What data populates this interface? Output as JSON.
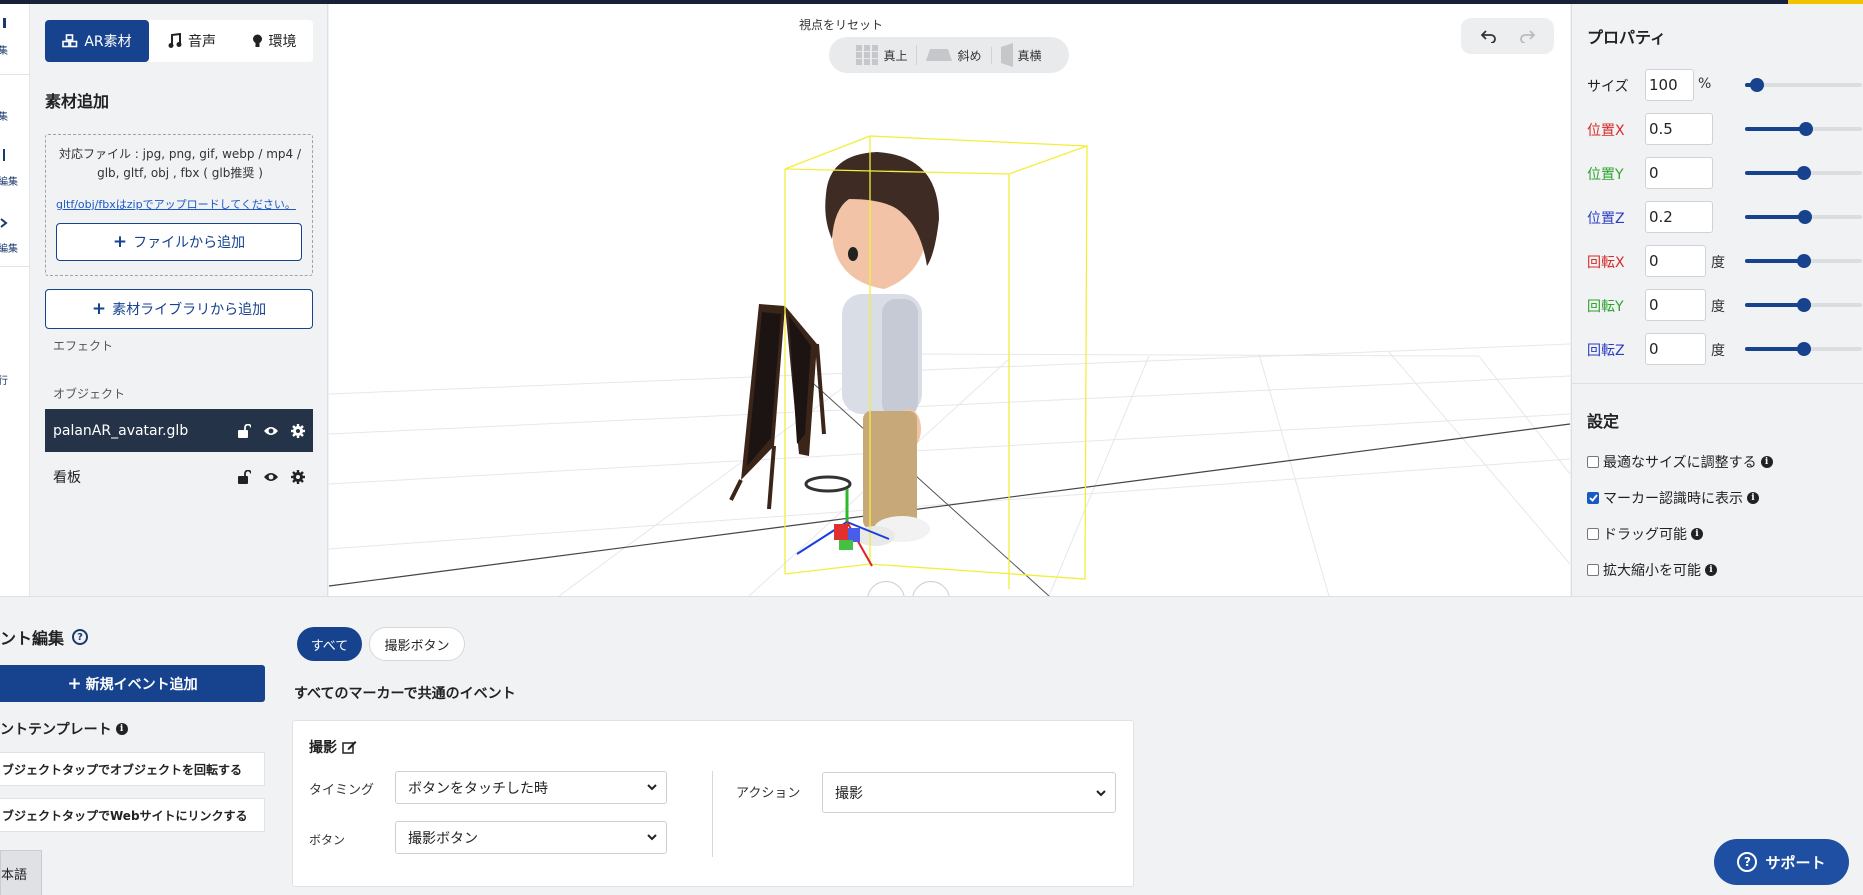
{
  "left_strip": {
    "items": [
      "集",
      "集",
      "編集",
      "編集",
      "行"
    ]
  },
  "asset_panel": {
    "tabs": [
      {
        "label": "AR素材",
        "icon": "cubes-icon"
      },
      {
        "label": "音声",
        "icon": "music-note-icon"
      },
      {
        "label": "環境",
        "icon": "lightbulb-icon"
      }
    ],
    "title": "素材追加",
    "upload_desc": "対応ファイル : jpg, png, gif, webp / mp4 / glb, gltf, obj , fbx ( glb推奨 )",
    "upload_link": "gltf/obj/fbxはzipでアップロードしてください。",
    "add_file_button": "ファイルから追加",
    "add_library_button": "素材ライブラリから追加",
    "effect_label": "エフェクト",
    "object_label": "オブジェクト",
    "objects": [
      {
        "name": "palanAR_avatar.glb",
        "selected": true
      },
      {
        "name": "看板",
        "selected": false
      }
    ]
  },
  "viewport": {
    "reset_label": "視点をリセット",
    "view_modes": [
      "真上",
      "斜め",
      "真横"
    ]
  },
  "properties": {
    "title": "プロパティ",
    "size": {
      "label": "サイズ",
      "value": "100",
      "unit": "%",
      "slider": 0.1,
      "color": "#222222"
    },
    "rows": [
      {
        "label": "位置X",
        "value": "0.5",
        "unit": "",
        "slider": 0.52,
        "color": "#d62a2a"
      },
      {
        "label": "位置Y",
        "value": "0",
        "unit": "",
        "slider": 0.5,
        "color": "#2ea32e"
      },
      {
        "label": "位置Z",
        "value": "0.2",
        "unit": "",
        "slider": 0.51,
        "color": "#2a3cc2"
      },
      {
        "label": "回転X",
        "value": "0",
        "unit": "度",
        "slider": 0.5,
        "color": "#d62a2a"
      },
      {
        "label": "回転Y",
        "value": "0",
        "unit": "度",
        "slider": 0.5,
        "color": "#2ea32e"
      },
      {
        "label": "回転Z",
        "value": "0",
        "unit": "度",
        "slider": 0.5,
        "color": "#2a3cc2"
      }
    ],
    "settings_title": "設定",
    "settings": [
      {
        "label": "最適なサイズに調整する",
        "checked": false
      },
      {
        "label": "マーカー認識時に表示",
        "checked": true
      },
      {
        "label": "ドラッグ可能",
        "checked": false
      },
      {
        "label": "拡大縮小を可能",
        "checked": false
      }
    ]
  },
  "events": {
    "title": "ント編集",
    "new_event_button": "新規イベント追加",
    "template_title": "ントテンプレート",
    "templates": [
      "ブジェクトタップでオブジェクトを回転する",
      "ブジェクトタップでWebサイトにリンクする"
    ],
    "language_button": "本語",
    "filters": [
      "すべて",
      "撮影ボタン"
    ],
    "common_title": "すべてのマーカーで共通のイベント",
    "card": {
      "title": "撮影",
      "timing_label": "タイミング",
      "timing_value": "ボタンをタッチした時",
      "button_label": "ボタン",
      "button_value": "撮影ボタン",
      "action_label": "アクション",
      "action_value": "撮影"
    }
  },
  "support_button": "サポート",
  "colors": {
    "primary": "#16428e",
    "dark_row": "#253348",
    "accent_bar": "#f2c200"
  }
}
